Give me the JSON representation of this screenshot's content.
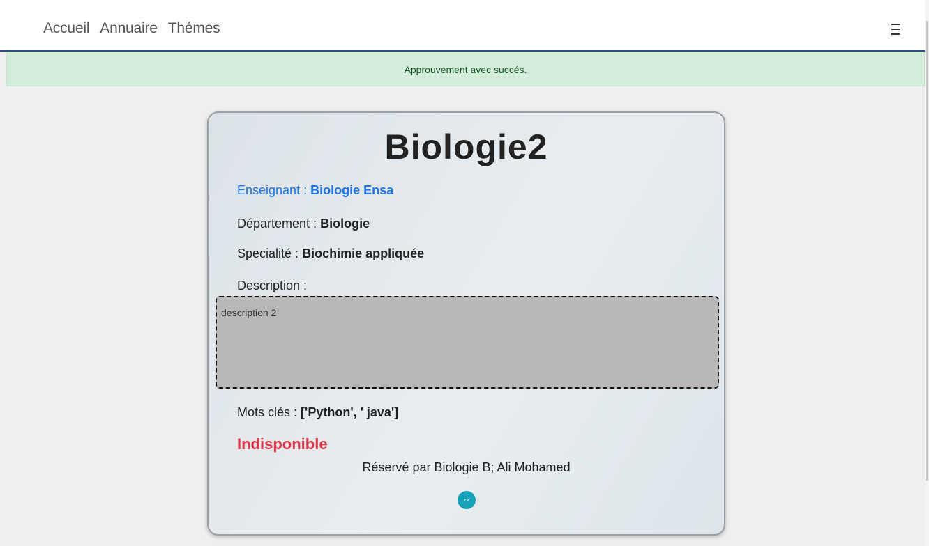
{
  "nav": {
    "links": [
      "Accueil",
      "Annuaire",
      "Thémes"
    ],
    "menu_icon": "hamburger-icon"
  },
  "alert": {
    "message": "Approuvement avec succés."
  },
  "card": {
    "title": "Biologie2",
    "teacher": {
      "label": "Enseignant :",
      "value": "Biologie Ensa"
    },
    "department": {
      "label": "Département :",
      "value": "Biologie"
    },
    "specialty": {
      "label": "Specialité :",
      "value": "Biochimie appliquée"
    },
    "description": {
      "label": "Description :",
      "value": "description 2"
    },
    "keywords": {
      "label": "Mots clés :",
      "value": "['Python', ' java']"
    },
    "status": "Indisponible",
    "reserved_by": "Réservé par Biologie B; Ali Mohamed",
    "contact_icon": "messenger-icon"
  },
  "colors": {
    "teacher_link": "#1a73e8",
    "status_unavailable": "#dc3545",
    "alert_bg": "#d4edda",
    "messenger": "#17a2b8"
  }
}
